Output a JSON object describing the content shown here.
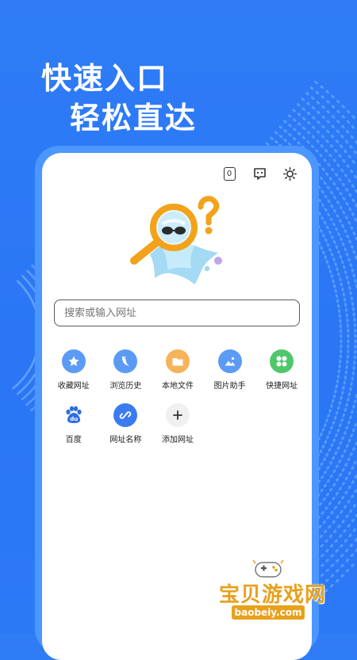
{
  "promo": {
    "headline_line1": "快速入口",
    "headline_line2": "轻松直达"
  },
  "browser": {
    "tab_count": "0",
    "search": {
      "placeholder": "搜索或输入网址",
      "value": ""
    },
    "shortcuts_row1": [
      {
        "label": "收藏网址",
        "icon": "star-icon",
        "color": "#5b9bf6"
      },
      {
        "label": "浏览历史",
        "icon": "history-icon",
        "color": "#5b9bf6"
      },
      {
        "label": "本地文件",
        "icon": "folder-icon",
        "color": "#f6a94a"
      },
      {
        "label": "图片助手",
        "icon": "image-icon",
        "color": "#5b9bf6"
      },
      {
        "label": "快捷网址",
        "icon": "grid-icon",
        "color": "#4fc76a"
      }
    ],
    "shortcuts_row2": [
      {
        "label": "百度",
        "icon": "baidu-paw-icon",
        "color": "#2f6ee0"
      },
      {
        "label": "网址名称",
        "icon": "link-icon",
        "color": "#3a7cf0"
      },
      {
        "label": "添加网址",
        "icon": "plus-icon",
        "color": "#f0f0f0"
      }
    ]
  },
  "watermark": {
    "title": "宝贝游戏网",
    "domain": "baobeiy.com"
  }
}
